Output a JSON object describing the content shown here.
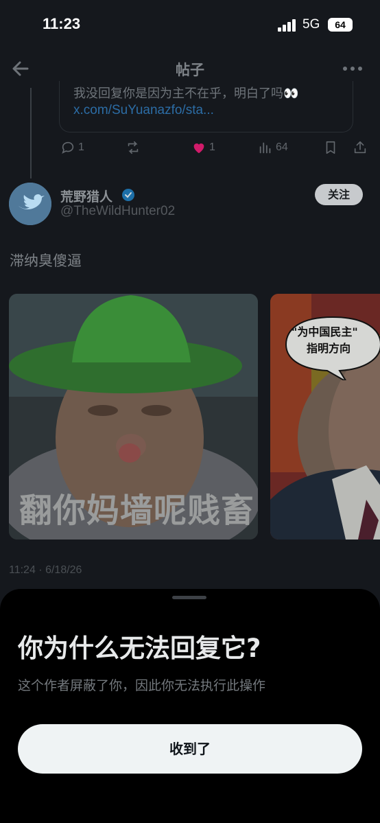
{
  "status_bar": {
    "time": "11:23",
    "network": "5G",
    "battery": "64"
  },
  "header": {
    "title": "帖子"
  },
  "quoted": {
    "text": "我没回复你是因为主不在乎，明白了吗👀",
    "link": "x.com/SuYuanazfo/sta..."
  },
  "actions": {
    "replies": "1",
    "likes": "1",
    "views": "64"
  },
  "author": {
    "name": "荒野猎人",
    "handle": "@TheWildHunter02",
    "follow_label": "关注"
  },
  "tweet": {
    "text": "滞纳臭傻逼",
    "media_caption": "翻你妈墙呢贱畜",
    "speech_bubble": [
      "\"为中国民主\"",
      "指明方向"
    ],
    "timestamp": "11:24 · 6/18/26"
  },
  "sheet": {
    "title": "你为什么无法回复它?",
    "subtitle": "这个作者屏蔽了你，因此你无法执行此操作",
    "button_label": "收到了"
  },
  "colors": {
    "like": "#d11b6a",
    "link": "#2c6da6",
    "verified": "#1d9bf0",
    "sheet_bg": "#000000",
    "button_bg": "#eff3f4"
  }
}
